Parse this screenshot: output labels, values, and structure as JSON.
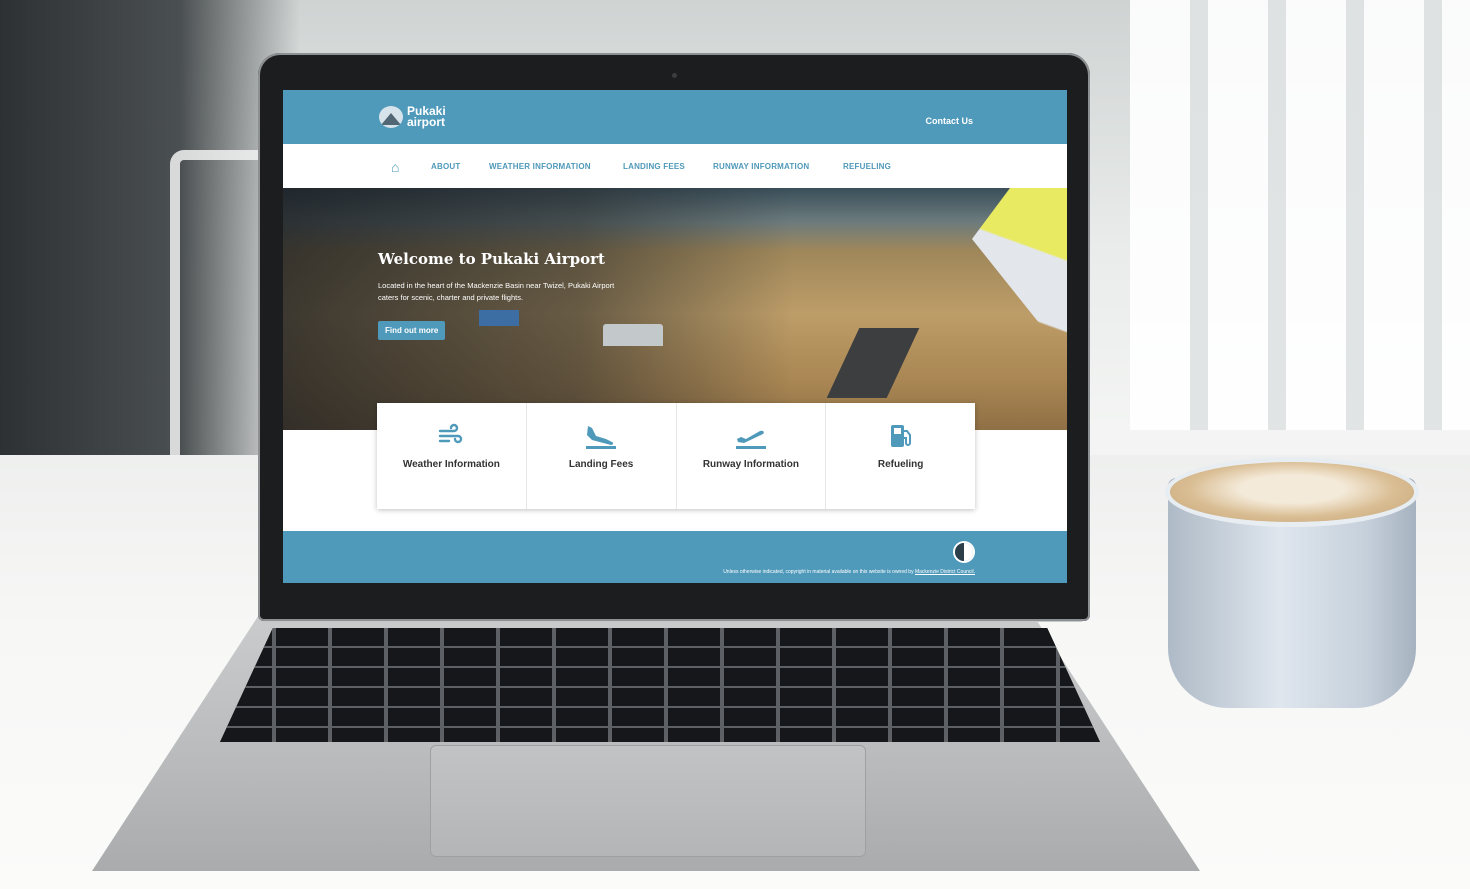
{
  "site": {
    "logo": {
      "line1": "Pukaki",
      "line2": "airport",
      "icon": "mountain-logo-icon"
    },
    "header_link": "Contact Us",
    "nav": {
      "home_icon": "home-icon",
      "items": [
        "ABOUT",
        "WEATHER INFORMATION",
        "LANDING FEES",
        "RUNWAY INFORMATION",
        "REFUELING"
      ]
    },
    "hero": {
      "title": "Welcome to Pukaki Airport",
      "text": "Located in the heart of the Mackenzie Basin near Twizel, Pukaki Airport caters for scenic, charter and private flights.",
      "button": "Find out more"
    },
    "cards": [
      {
        "label": "Weather Information",
        "icon": "wind-icon"
      },
      {
        "label": "Landing Fees",
        "icon": "plane-landing-icon"
      },
      {
        "label": "Runway Information",
        "icon": "plane-takeoff-icon"
      },
      {
        "label": "Refueling",
        "icon": "fuel-pump-icon"
      }
    ],
    "footer": {
      "text": "Unless otherwise indicated, copyright in material available on this website is owned by",
      "link": "Mackenzie District Council."
    }
  },
  "colors": {
    "brand": "#4f99ba",
    "text": "#333333",
    "white": "#ffffff"
  }
}
